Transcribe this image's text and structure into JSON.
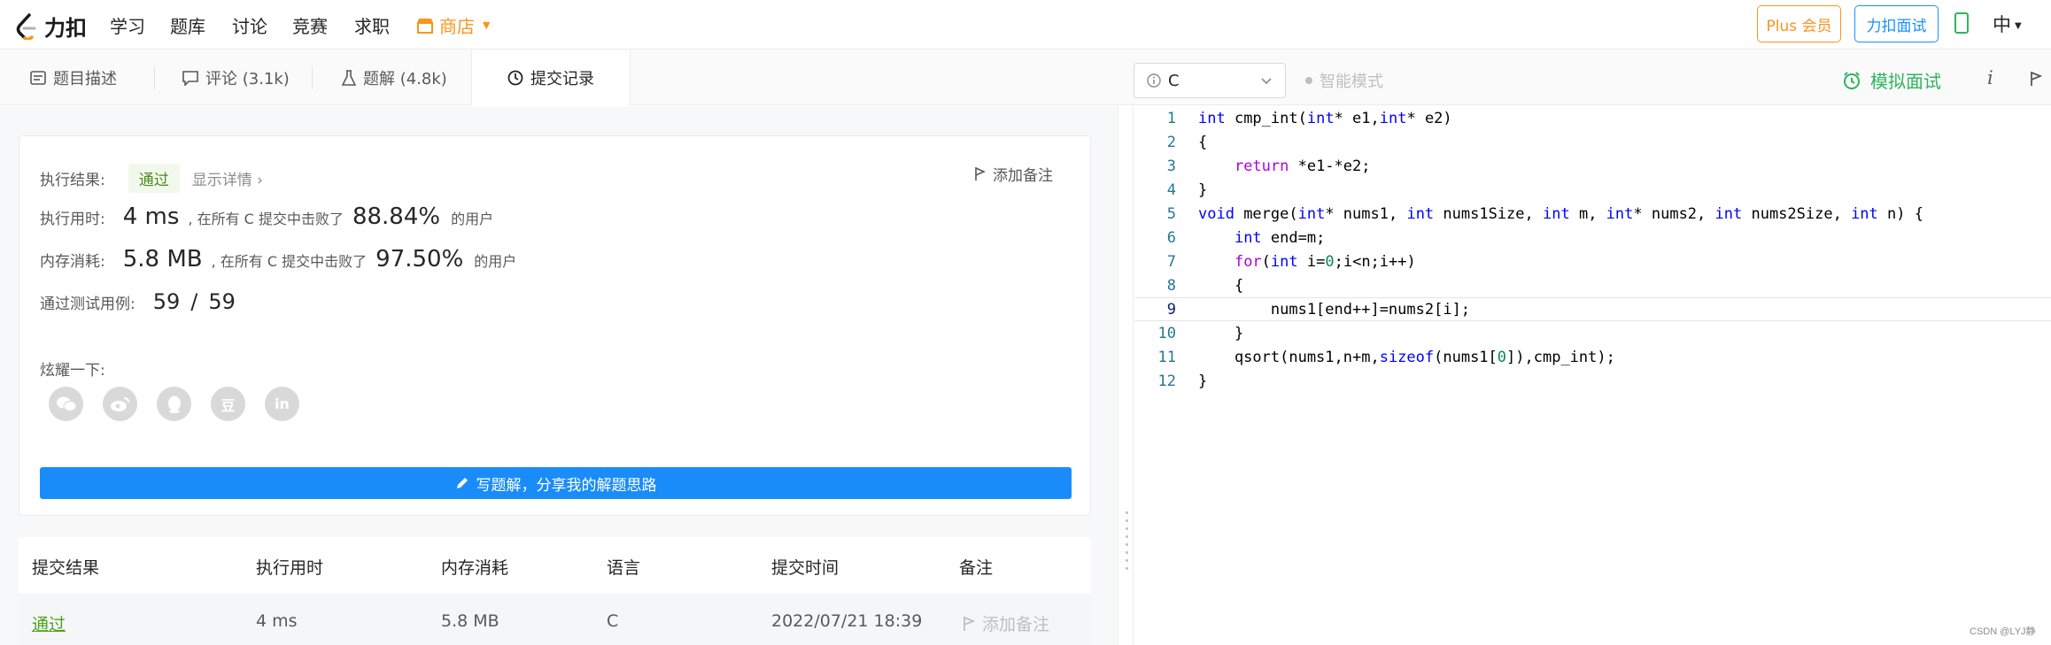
{
  "nav": {
    "logo_text": "力扣",
    "links": [
      "学习",
      "题库",
      "讨论",
      "竞赛",
      "求职"
    ],
    "store_label": "商店",
    "plus_label": "Plus 会员",
    "interview_label": "力扣面试",
    "lang_label": "中",
    "brand_color": "#f7961d"
  },
  "tabs": [
    {
      "label": "题目描述",
      "icon": "description-icon"
    },
    {
      "label": "评论 (3.1k)",
      "icon": "comment-icon"
    },
    {
      "label": "题解 (4.8k)",
      "icon": "flask-icon"
    },
    {
      "label": "提交记录",
      "icon": "clock-icon"
    }
  ],
  "editor_toolbar": {
    "language": "C",
    "smart_mode": "智能模式",
    "mock_interview": "模拟面试"
  },
  "result": {
    "result_label": "执行结果:",
    "status": "通过",
    "details_link": "显示详情",
    "add_note": "添加备注",
    "runtime_label": "执行用时:",
    "runtime_value": "4 ms",
    "beat_text_pre": ", 在所有 C 提交中击败了",
    "runtime_pct": "88.84%",
    "users_suffix": "的用户",
    "memory_label": "内存消耗:",
    "memory_value": "5.8 MB",
    "memory_pct": "97.50%",
    "testcases_label": "通过测试用例:",
    "testcases_passed": "59",
    "testcases_sep": "/",
    "testcases_total": "59",
    "share_label": "炫耀一下:",
    "share_icons": [
      "wechat-icon",
      "weibo-icon",
      "qq-icon",
      "douban-icon",
      "linkedin-icon"
    ],
    "douban_glyph": "豆",
    "linkedin_glyph": "in",
    "write_button": "写题解，分享我的解题思路"
  },
  "history": {
    "headers": [
      "提交结果",
      "执行用时",
      "内存消耗",
      "语言",
      "提交时间",
      "备注"
    ],
    "rows": [
      {
        "result": "通过",
        "runtime": "4 ms",
        "memory": "5.8 MB",
        "language": "C",
        "time": "2022/07/21 18:39",
        "note": "添加备注"
      }
    ]
  },
  "code": {
    "line_numbers": [
      "1",
      "2",
      "3",
      "4",
      "5",
      "6",
      "7",
      "8",
      "9",
      "10",
      "11",
      "12"
    ],
    "lines": [
      "int cmp_int(int* e1,int* e2)",
      "{",
      "    return *e1-*e2;",
      "}",
      "void merge(int* nums1, int nums1Size, int m, int* nums2, int nums2Size, int n) {",
      "    int end=m;",
      "    for(int i=0;i<n;i++)",
      "    {",
      "        nums1[end++]=nums2[i];",
      "    }",
      "    qsort(nums1,n+m,sizeof(nums1[0]),cmp_int);",
      "}"
    ]
  },
  "watermark": "CSDN @LYJ静"
}
